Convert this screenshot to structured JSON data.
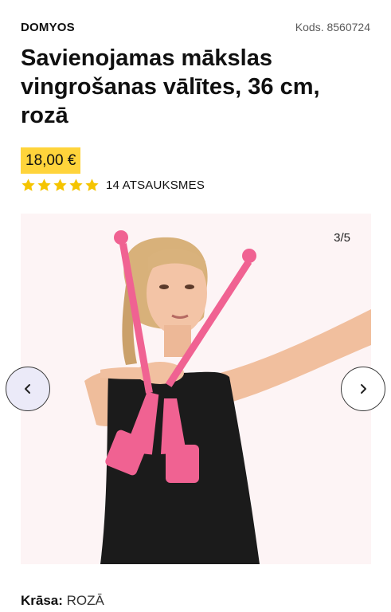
{
  "product": {
    "brand": "DOMYOS",
    "code": "Kods. 8560724",
    "title": "Savienojamas mākslas vingrošanas vālītes, 36 cm, rozā",
    "price": "18,00 €",
    "rating": {
      "stars": 5,
      "reviews_label": "14 ATSAUKSMES"
    }
  },
  "gallery": {
    "counter": "3/5",
    "current": 3,
    "total": 5
  },
  "color": {
    "label": "Krāsa:",
    "value": "ROZĀ"
  },
  "colors": {
    "price_highlight": "#ffd43b",
    "stars": "#f5c400",
    "clubs": "#f06292"
  },
  "icons": {
    "prev": "chevron-left-icon",
    "next": "chevron-right-icon",
    "star": "star-icon"
  }
}
